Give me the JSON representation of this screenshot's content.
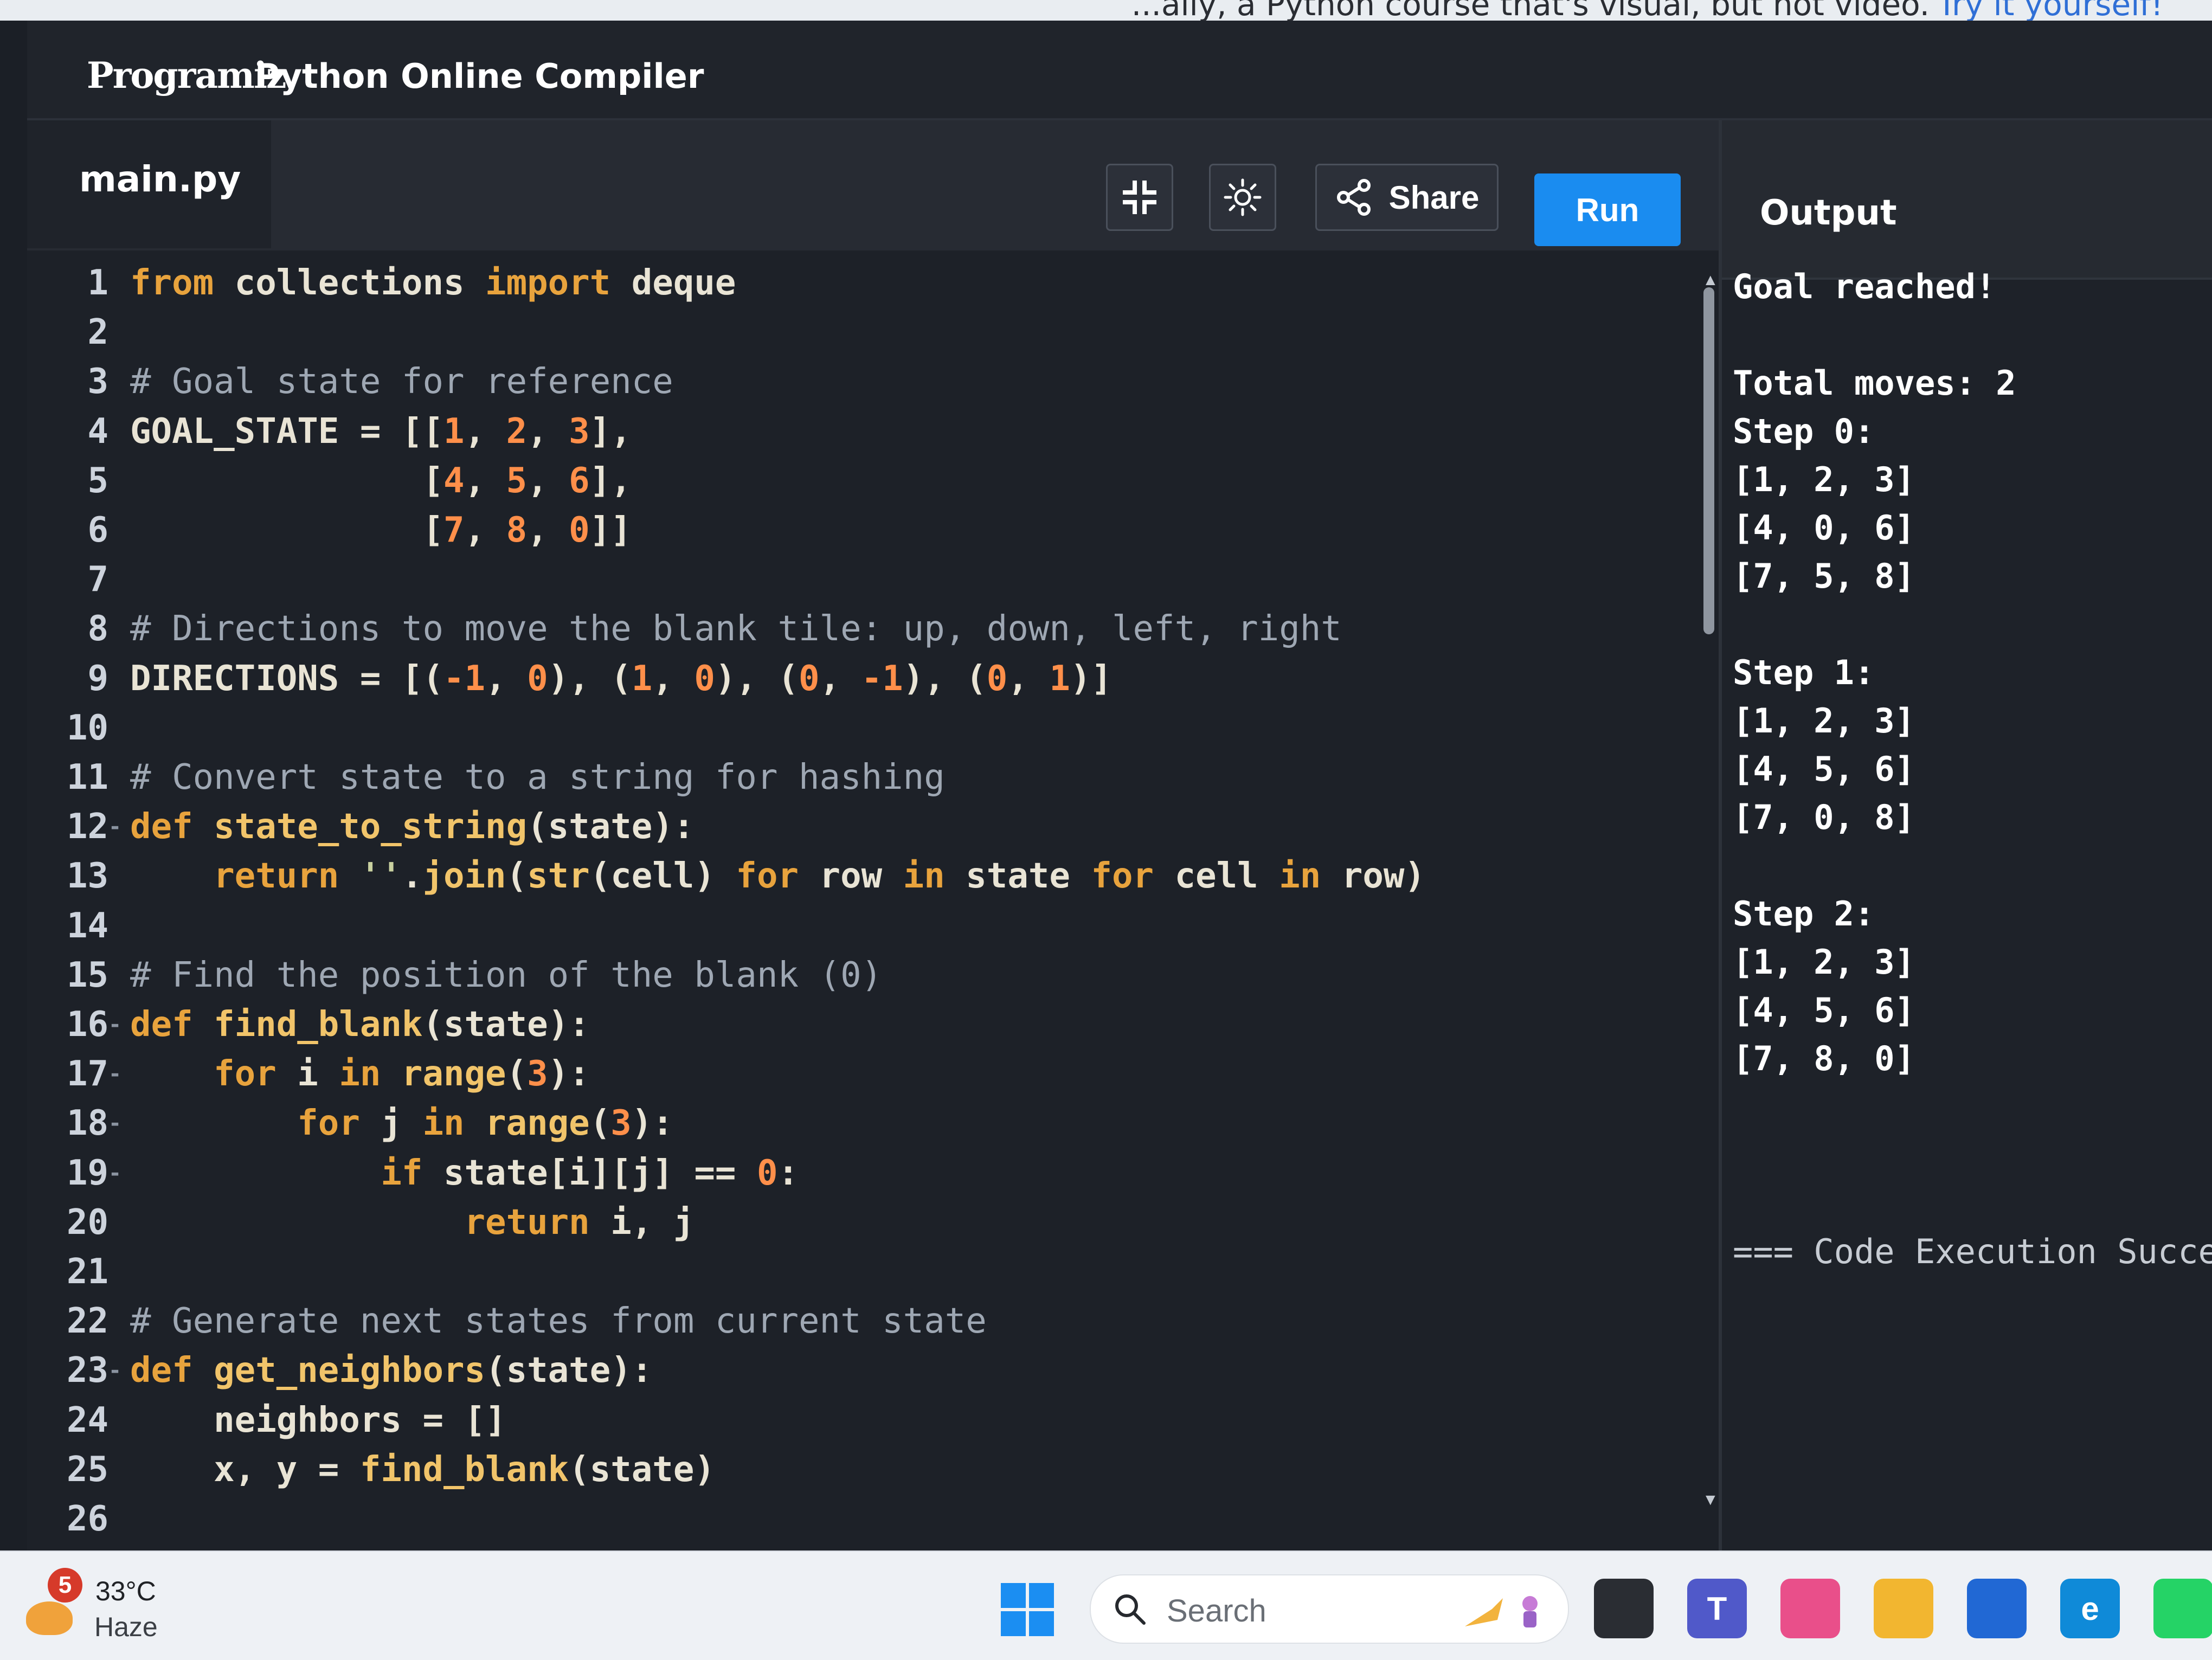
{
  "banner": {
    "text": "...ally, a Python course that's visual, but not video.",
    "link": "Try it yourself!"
  },
  "header": {
    "logo": "Programiz",
    "title": "Python Online Compiler"
  },
  "editor": {
    "filename": "main.py",
    "share_label": "Share",
    "run_label": "Run",
    "lines": [
      {
        "n": "1",
        "fold": "",
        "html": "<span class='kw'>from</span> collections <span class='kw'>import</span> deque"
      },
      {
        "n": "2",
        "fold": "",
        "html": ""
      },
      {
        "n": "3",
        "fold": "",
        "html": "<span class='cm'># Goal state for reference</span>"
      },
      {
        "n": "4",
        "fold": "",
        "html": "GOAL_STATE = [[<span class='num'>1</span>, <span class='num'>2</span>, <span class='num'>3</span>],"
      },
      {
        "n": "5",
        "fold": "",
        "html": "              [<span class='num'>4</span>, <span class='num'>5</span>, <span class='num'>6</span>],"
      },
      {
        "n": "6",
        "fold": "",
        "html": "              [<span class='num'>7</span>, <span class='num'>8</span>, <span class='num'>0</span>]]"
      },
      {
        "n": "7",
        "fold": "",
        "html": ""
      },
      {
        "n": "8",
        "fold": "",
        "html": "<span class='cm'># Directions to move the blank tile: up, down, left, right</span>"
      },
      {
        "n": "9",
        "fold": "",
        "html": "DIRECTIONS = [(<span class='num'>-1</span>, <span class='num'>0</span>), (<span class='num'>1</span>, <span class='num'>0</span>), (<span class='num'>0</span>, <span class='num'>-1</span>), (<span class='num'>0</span>, <span class='num'>1</span>)]"
      },
      {
        "n": "10",
        "fold": "",
        "html": ""
      },
      {
        "n": "11",
        "fold": "",
        "html": "<span class='cm'># Convert state to a string for hashing</span>"
      },
      {
        "n": "12",
        "fold": "-",
        "html": "<span class='kw'>def</span> <span class='fn'>state_to_string</span>(state):"
      },
      {
        "n": "13",
        "fold": "",
        "html": "    <span class='kw'>return</span> <span class='str'>''</span>.<span class='fn'>join</span>(<span class='fn'>str</span>(cell) <span class='kw'>for</span> row <span class='kw'>in</span> state <span class='kw'>for</span> cell <span class='kw'>in</span> row)"
      },
      {
        "n": "14",
        "fold": "",
        "html": ""
      },
      {
        "n": "15",
        "fold": "",
        "html": "<span class='cm'># Find the position of the blank (0)</span>"
      },
      {
        "n": "16",
        "fold": "-",
        "html": "<span class='kw'>def</span> <span class='fn'>find_blank</span>(state):"
      },
      {
        "n": "17",
        "fold": "-",
        "html": "    <span class='kw'>for</span> i <span class='kw'>in</span> <span class='fn'>range</span>(<span class='num'>3</span>):"
      },
      {
        "n": "18",
        "fold": "-",
        "html": "        <span class='kw'>for</span> j <span class='kw'>in</span> <span class='fn'>range</span>(<span class='num'>3</span>):"
      },
      {
        "n": "19",
        "fold": "-",
        "html": "            <span class='kw'>if</span> state[i][j] == <span class='num'>0</span>:"
      },
      {
        "n": "20",
        "fold": "",
        "html": "                <span class='kw'>return</span> i, j"
      },
      {
        "n": "21",
        "fold": "",
        "html": ""
      },
      {
        "n": "22",
        "fold": "",
        "html": "<span class='cm'># Generate next states from current state</span>"
      },
      {
        "n": "23",
        "fold": "-",
        "html": "<span class='kw'>def</span> <span class='fn'>get_neighbors</span>(state):"
      },
      {
        "n": "24",
        "fold": "",
        "html": "    neighbors = []"
      },
      {
        "n": "25",
        "fold": "",
        "html": "    x, y = <span class='fn'>find_blank</span>(state)"
      },
      {
        "n": "26",
        "fold": "",
        "html": ""
      }
    ]
  },
  "output": {
    "title": "Output",
    "lines": [
      {
        "text": "Goal reached!",
        "muted": false
      },
      {
        "text": "",
        "muted": false
      },
      {
        "text": "Total moves: 2",
        "muted": false
      },
      {
        "text": "Step 0:",
        "muted": false
      },
      {
        "text": "[1, 2, 3]",
        "muted": false
      },
      {
        "text": "[4, 0, 6]",
        "muted": false
      },
      {
        "text": "[7, 5, 8]",
        "muted": false
      },
      {
        "text": "",
        "muted": false
      },
      {
        "text": "Step 1:",
        "muted": false
      },
      {
        "text": "[1, 2, 3]",
        "muted": false
      },
      {
        "text": "[4, 5, 6]",
        "muted": false
      },
      {
        "text": "[7, 0, 8]",
        "muted": false
      },
      {
        "text": "",
        "muted": false
      },
      {
        "text": "Step 2:",
        "muted": false
      },
      {
        "text": "[1, 2, 3]",
        "muted": false
      },
      {
        "text": "[4, 5, 6]",
        "muted": false
      },
      {
        "text": "[7, 8, 0]",
        "muted": false
      },
      {
        "text": "",
        "muted": false
      },
      {
        "text": "",
        "muted": false
      },
      {
        "text": "",
        "muted": false
      },
      {
        "text": "=== Code Execution Successf",
        "muted": true
      }
    ]
  },
  "taskbar": {
    "weather_badge": "5",
    "temperature": "33°C",
    "condition": "Haze",
    "search_placeholder": "Search",
    "apps": [
      {
        "name": "file-explorer-icon",
        "label": "",
        "color": "#2a2d33"
      },
      {
        "name": "teams-icon",
        "label": "T",
        "color": "#5059c9"
      },
      {
        "name": "copilot-icon",
        "label": "",
        "color": "#e94f8a"
      },
      {
        "name": "folder-icon",
        "label": "",
        "color": "#f2b630"
      },
      {
        "name": "store-icon",
        "label": "",
        "color": "#2168d4"
      },
      {
        "name": "edge-icon",
        "label": "e",
        "color": "#0f8ad8"
      },
      {
        "name": "whatsapp-icon",
        "label": "",
        "color": "#25d366"
      }
    ]
  }
}
